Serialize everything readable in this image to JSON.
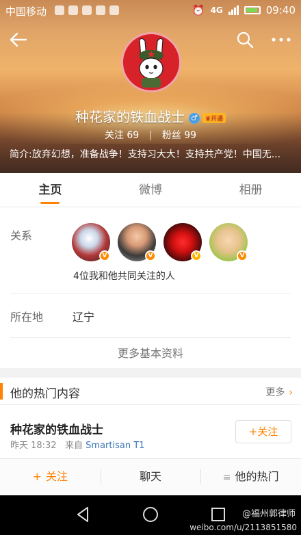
{
  "statusbar": {
    "carrier": "中国移动",
    "network": "4G",
    "time": "09:40"
  },
  "nav": {
    "back_icon": "arrow-left-icon",
    "search_icon": "search-icon",
    "more_icon": "more-dots-icon"
  },
  "profile": {
    "name": "种花家的铁血战士",
    "gender_symbol": "♂",
    "vip_label": "开通",
    "following_label": "关注",
    "following_count": "69",
    "followers_label": "粉丝",
    "followers_count": "99",
    "intro": "简介:放弃幻想，准备战争！支持习大大！支持共产党！中国无..."
  },
  "tabs": [
    {
      "label": "主页",
      "active": true
    },
    {
      "label": "微博",
      "active": false
    },
    {
      "label": "相册",
      "active": false
    }
  ],
  "info": {
    "relations_label": "关系",
    "mutual_text": "4位我和他共同关注的人",
    "location_label": "所在地",
    "location_value": "辽宁",
    "more_info": "更多基本资料"
  },
  "hot": {
    "title": "他的热门内容",
    "more": "更多",
    "more_arrow": "›"
  },
  "post": {
    "author": "种花家的铁血战士",
    "time": "昨天 18:32",
    "from_label": "来自",
    "source": "Smartisan T1",
    "follow_button": "+关注"
  },
  "toolbar": {
    "follow_icon": "+",
    "follow": "关注",
    "chat": "聊天",
    "hot": "他的热门"
  },
  "watermark": {
    "line1": "@福州郭律师",
    "line2": "weibo.com/u/2113851580"
  },
  "colors": {
    "accent": "#ff8200",
    "link": "#3a76b8",
    "avatar_bg": "#d8222a"
  }
}
